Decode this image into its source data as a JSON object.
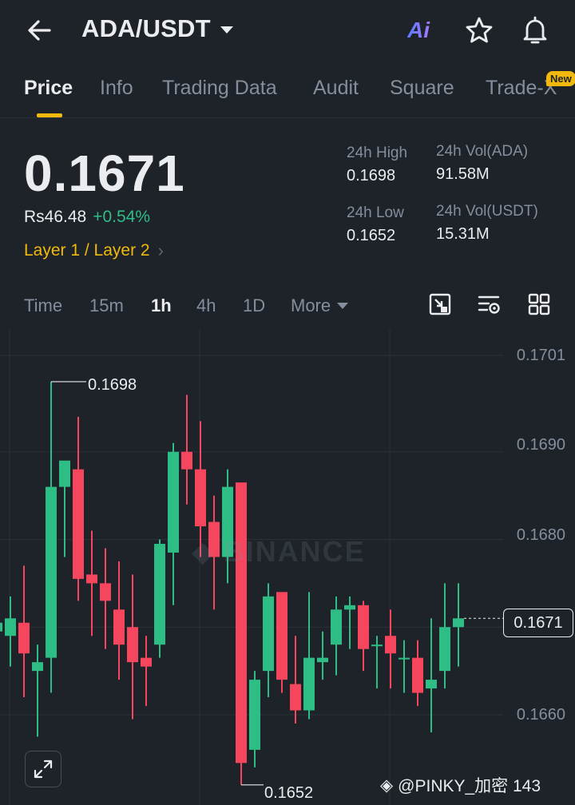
{
  "header": {
    "pair": "ADA/USDT",
    "ai_label": "Ai"
  },
  "tabs": [
    {
      "label": "Price",
      "active": true
    },
    {
      "label": "Info"
    },
    {
      "label": "Trading Data"
    },
    {
      "label": "Audit"
    },
    {
      "label": "Square"
    },
    {
      "label": "Trade-X"
    }
  ],
  "new_badge": "New",
  "ticker": {
    "price": "0.1671",
    "fiat": "Rs46.48",
    "change": "+0.54%",
    "tags": "Layer 1 / Layer 2",
    "high_label": "24h High",
    "high": "0.1698",
    "low_label": "24h Low",
    "low": "0.1652",
    "vol_base_label": "24h Vol(ADA)",
    "vol_base": "91.58M",
    "vol_quote_label": "24h Vol(USDT)",
    "vol_quote": "15.31M"
  },
  "intervals": [
    {
      "label": "Time"
    },
    {
      "label": "15m"
    },
    {
      "label": "1h",
      "active": true
    },
    {
      "label": "4h"
    },
    {
      "label": "1D"
    },
    {
      "label": "More"
    }
  ],
  "colors": {
    "up": "#2ebd85",
    "down": "#f6465d",
    "accent": "#f0b90b",
    "bg": "#1e2329"
  },
  "watermark": "BINANCE",
  "credit": "@PINKY_加密 143",
  "chart_data": {
    "type": "candlestick",
    "y_ticks": [
      "0.1701",
      "0.1690",
      "0.1680",
      "0.1660"
    ],
    "ylim": [
      0.1647,
      0.1705
    ],
    "last_price": "0.1671",
    "high_label": "0.1698",
    "low_label": "0.1652",
    "candles": [
      {
        "o": 0.16695,
        "h": 0.16725,
        "l": 0.16615,
        "c": 0.16705
      },
      {
        "o": 0.1669,
        "h": 0.16735,
        "l": 0.16655,
        "c": 0.1671
      },
      {
        "o": 0.16705,
        "h": 0.1677,
        "l": 0.1662,
        "c": 0.1667
      },
      {
        "o": 0.1665,
        "h": 0.1668,
        "l": 0.16575,
        "c": 0.1666
      },
      {
        "o": 0.16665,
        "h": 0.1698,
        "l": 0.16625,
        "c": 0.1686
      },
      {
        "o": 0.1686,
        "h": 0.16885,
        "l": 0.1678,
        "c": 0.1689
      },
      {
        "o": 0.1688,
        "h": 0.1694,
        "l": 0.1673,
        "c": 0.16755
      },
      {
        "o": 0.1676,
        "h": 0.1681,
        "l": 0.1669,
        "c": 0.1675
      },
      {
        "o": 0.1675,
        "h": 0.1679,
        "l": 0.16675,
        "c": 0.1673
      },
      {
        "o": 0.1672,
        "h": 0.16775,
        "l": 0.1664,
        "c": 0.1668
      },
      {
        "o": 0.167,
        "h": 0.1676,
        "l": 0.16595,
        "c": 0.1666
      },
      {
        "o": 0.16665,
        "h": 0.1669,
        "l": 0.1661,
        "c": 0.16655
      },
      {
        "o": 0.1668,
        "h": 0.168,
        "l": 0.16665,
        "c": 0.16795
      },
      {
        "o": 0.16785,
        "h": 0.1691,
        "l": 0.16725,
        "c": 0.169
      },
      {
        "o": 0.169,
        "h": 0.16965,
        "l": 0.1684,
        "c": 0.1688
      },
      {
        "o": 0.1688,
        "h": 0.16935,
        "l": 0.1678,
        "c": 0.16815
      },
      {
        "o": 0.1682,
        "h": 0.1685,
        "l": 0.1672,
        "c": 0.1678
      },
      {
        "o": 0.1678,
        "h": 0.1688,
        "l": 0.1675,
        "c": 0.1686
      },
      {
        "o": 0.16865,
        "h": 0.16865,
        "l": 0.1652,
        "c": 0.16545
      },
      {
        "o": 0.1656,
        "h": 0.1665,
        "l": 0.1654,
        "c": 0.1664
      },
      {
        "o": 0.1665,
        "h": 0.1675,
        "l": 0.1662,
        "c": 0.16735
      },
      {
        "o": 0.1674,
        "h": 0.1674,
        "l": 0.16625,
        "c": 0.1664
      },
      {
        "o": 0.16635,
        "h": 0.1669,
        "l": 0.1659,
        "c": 0.16605
      },
      {
        "o": 0.16605,
        "h": 0.1674,
        "l": 0.16595,
        "c": 0.16665
      },
      {
        "o": 0.1666,
        "h": 0.16695,
        "l": 0.1664,
        "c": 0.16665
      },
      {
        "o": 0.1668,
        "h": 0.16735,
        "l": 0.16645,
        "c": 0.1672
      },
      {
        "o": 0.1672,
        "h": 0.16735,
        "l": 0.16675,
        "c": 0.16725
      },
      {
        "o": 0.16725,
        "h": 0.1673,
        "l": 0.1665,
        "c": 0.16675
      },
      {
        "o": 0.1668,
        "h": 0.1669,
        "l": 0.1663,
        "c": 0.1668
      },
      {
        "o": 0.1669,
        "h": 0.1672,
        "l": 0.1663,
        "c": 0.1667
      },
      {
        "o": 0.16665,
        "h": 0.16685,
        "l": 0.16625,
        "c": 0.16665
      },
      {
        "o": 0.16665,
        "h": 0.16685,
        "l": 0.1661,
        "c": 0.16625
      },
      {
        "o": 0.1663,
        "h": 0.1671,
        "l": 0.1658,
        "c": 0.1664
      },
      {
        "o": 0.1665,
        "h": 0.1675,
        "l": 0.1663,
        "c": 0.167
      },
      {
        "o": 0.167,
        "h": 0.1675,
        "l": 0.16655,
        "c": 0.1671
      }
    ]
  }
}
